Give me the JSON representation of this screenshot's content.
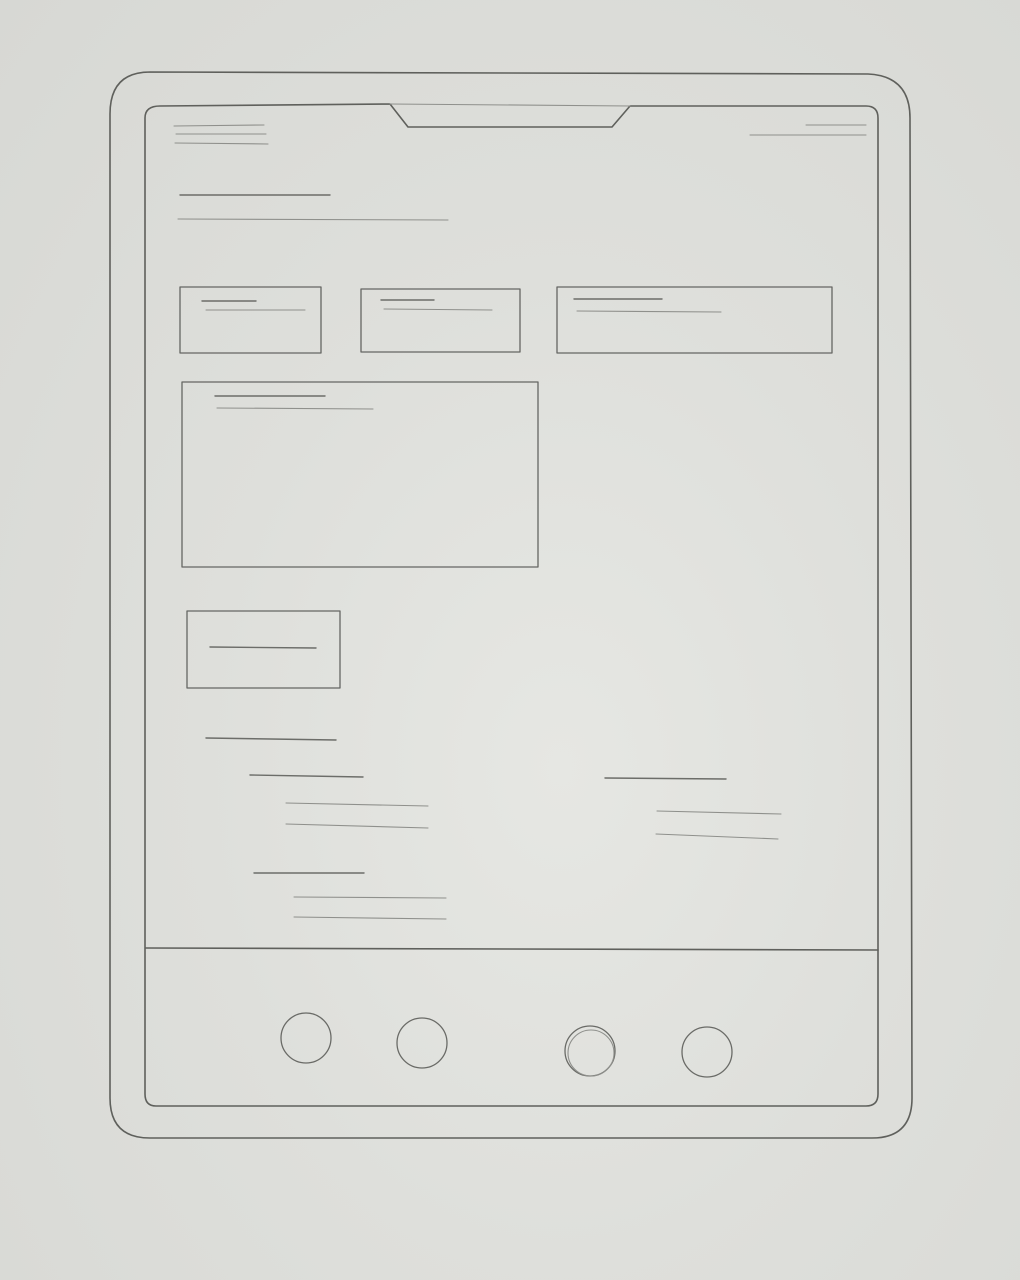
{
  "sketch": {
    "kind": "tablet wireframe",
    "icons": [
      "nav-circle-icon",
      "nav-circle-icon",
      "nav-circle-icon",
      "nav-circle-icon"
    ]
  }
}
